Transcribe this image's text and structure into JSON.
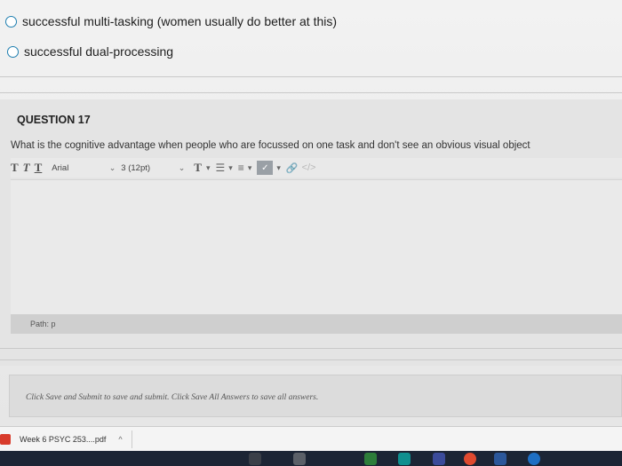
{
  "previous_options": [
    {
      "text": "successful multi-tasking (women usually do better at this)"
    },
    {
      "text": "successful dual-processing"
    }
  ],
  "question": {
    "title": "QUESTION 17",
    "prompt": "What is the cognitive advantage when people who are focussed on one task and don't see an obvious visual object"
  },
  "toolbar": {
    "format_t1": "T",
    "format_t2": "T",
    "format_t3": "T",
    "font_value": "Arial",
    "size_value": "3 (12pt)",
    "text_color": "T",
    "icons": [
      "text-color-icon",
      "bullet-list-icon",
      "numbered-list-icon",
      "spellcheck-icon",
      "link-icon",
      "code-icon"
    ]
  },
  "editor": {
    "path_label": "Path: p"
  },
  "save_bar": {
    "text": "Click Save and Submit to save and submit. Click Save All Answers to save all answers."
  },
  "download": {
    "file_name": "Week 6  PSYC 253....pdf"
  },
  "colors": {
    "radio_border": "#1f7fb0",
    "pdf_icon": "#d83b2b",
    "taskbar": "#1c2535"
  }
}
